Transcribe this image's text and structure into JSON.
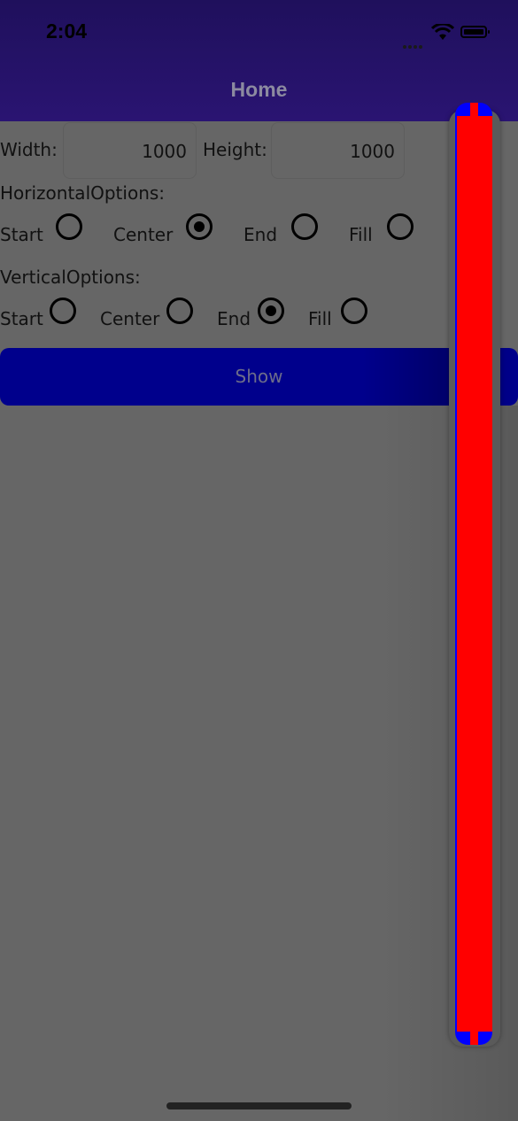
{
  "status_bar": {
    "time": "2:04"
  },
  "nav": {
    "title": "Home"
  },
  "size_row": {
    "width_label": "Width:",
    "width_value": "1000",
    "height_label": "Height:",
    "height_value": "1000"
  },
  "horizontal": {
    "label": "HorizontalOptions:",
    "options": [
      "Start",
      "Center",
      "End",
      "Fill"
    ],
    "selected": "Center"
  },
  "vertical": {
    "label": "VerticalOptions:",
    "options": [
      "Start",
      "Center",
      "End",
      "Fill"
    ],
    "selected": "End"
  },
  "show_button": {
    "label": "Show"
  },
  "colors": {
    "header": "#2a1472",
    "button": "#00008c",
    "popup_border": "#0000ff",
    "popup_fill": "#ff0000"
  }
}
